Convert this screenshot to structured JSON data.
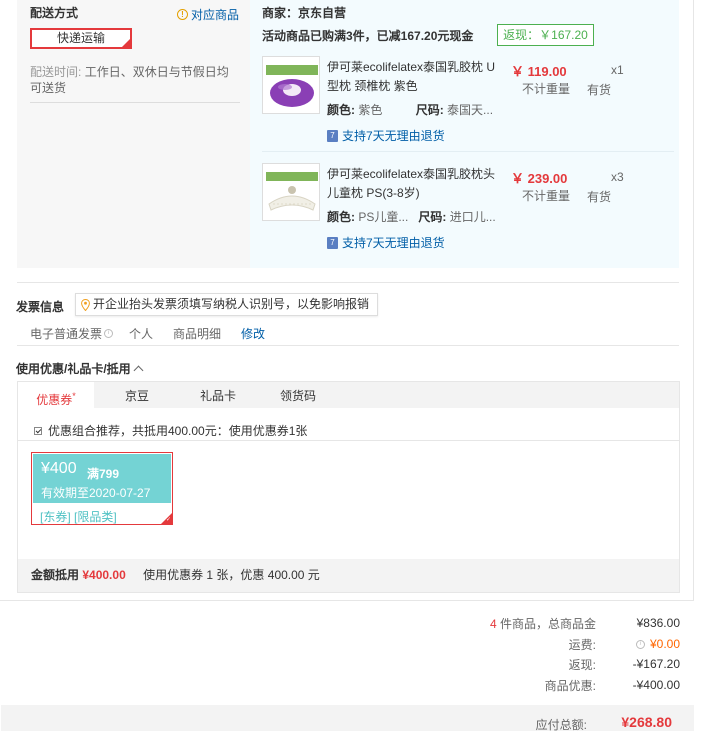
{
  "shipping": {
    "title": "配送方式",
    "link": "对应商品",
    "method": "快递运输",
    "time_label": "配送时间:",
    "time_value": "工作日、双休日与节假日均可送货"
  },
  "goods": {
    "merchant": "商家：京东自营",
    "promo": "活动商品已购满3件，已减167.20元现金",
    "rebate": "返现：￥167.20",
    "items": [
      {
        "name": "伊可莱ecolifelatex泰国乳胶枕 U型枕 颈椎枕 紫色",
        "color_label": "颜色:",
        "color": "紫色",
        "size_label": "尺码:",
        "size": "泰国天...",
        "price": "￥ 119.00",
        "weight": "不计重量",
        "qty": "x1",
        "stock": "有货",
        "return": "支持7天无理由退货"
      },
      {
        "name": "伊可莱ecolifelatex泰国乳胶枕头 儿童枕 PS(3-8岁)",
        "color_label": "颜色:",
        "color": "PS儿童...",
        "size_label": "尺码:",
        "size": "进口儿...",
        "price": "￥ 239.00",
        "weight": "不计重量",
        "qty": "x3",
        "stock": "有货",
        "return": "支持7天无理由退货"
      }
    ]
  },
  "invoice": {
    "title": "发票信息",
    "tip": "开企业抬头发票须填写纳税人识别号，以免影响报销",
    "type": "电子普通发票",
    "header": "个人",
    "content": "商品明细",
    "edit": "修改"
  },
  "coupons": {
    "title": "使用优惠/礼品卡/抵用",
    "tabs": [
      "优惠券",
      "京豆",
      "礼品卡",
      "领货码"
    ],
    "tab_mark": "*",
    "combo_text": "优惠组合推荐，共抵用400.00元：使用优惠券1张",
    "coupon": {
      "amount": "¥400",
      "condition": "满799",
      "valid": "有效期至2020-07-27",
      "tags": "[东券] [限品类]"
    },
    "total_label": "金额抵用",
    "total_value": "¥400.00",
    "total_desc": "使用优惠券 1 张，优惠 400.00 元"
  },
  "summary": {
    "count": "4",
    "count_label": " 件商品，总商品金",
    "goods_amount": "¥836.00",
    "shipping_label": "运费:",
    "shipping_value": "¥0.00",
    "rebate_label": "返现:",
    "rebate_value": "-¥167.20",
    "discount_label": "商品优惠:",
    "discount_value": "-¥400.00",
    "pay_label": "应付总额:",
    "pay_value": "¥268.80"
  },
  "colors": {
    "accent_red": "#e4393c",
    "link_blue": "#005ea7",
    "rebate_green": "#4cb050",
    "coupon_teal": "#74d3d4"
  }
}
